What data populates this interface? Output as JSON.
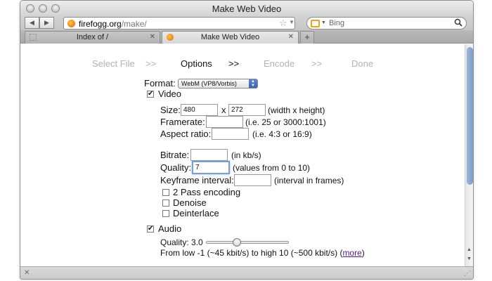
{
  "window": {
    "title": "Make Web Video"
  },
  "navbar": {
    "back_icon": "back-arrow-icon",
    "forward_icon": "forward-arrow-icon",
    "url_host": "firefogg.org",
    "url_path": "/make/",
    "search_engine": "Bing",
    "search_placeholder": "Bing"
  },
  "tabs": [
    {
      "label": "Index of /",
      "active": false
    },
    {
      "label": "Make Web Video",
      "active": true
    }
  ],
  "steps": {
    "select_file": "Select File",
    "sep1": ">>",
    "options": "Options",
    "sep2": ">>",
    "encode": "Encode",
    "sep3": ">>",
    "done": "Done",
    "current": "Options"
  },
  "form": {
    "format_label": "Format:",
    "format_value": "WebM (VP8/Vorbis)",
    "video_label": "Video",
    "video_checked": true,
    "size_label": "Size:",
    "width_value": "480",
    "size_x": "x",
    "height_value": "272",
    "size_note": "(width x height)",
    "framerate_label": "Framerate:",
    "framerate_value": "",
    "framerate_note": "(i.e. 25 or 3000:1001)",
    "aspect_label": "Aspect ratio:",
    "aspect_value": "",
    "aspect_note": "(i.e. 4:3 or 16:9)",
    "bitrate_label": "Bitrate:",
    "bitrate_value": "",
    "bitrate_note": "(in kb/s)",
    "quality_label": "Quality:",
    "quality_value": "7",
    "quality_note": "(values from 0 to 10)",
    "keyframe_label": "Keyframe interval:",
    "keyframe_value": "",
    "keyframe_note": "(interval in frames)",
    "twopass_label": "2 Pass encoding",
    "twopass_checked": false,
    "denoise_label": "Denoise",
    "denoise_checked": false,
    "deinterlace_label": "Deinterlace",
    "deinterlace_checked": false,
    "audio_label": "Audio",
    "audio_checked": true,
    "audio_quality_label": "Quality: 3.0",
    "audio_quality_fraction": 0.36,
    "audio_range_text": "From low -1 (~45 kbit/s) to high 10 (~500 kbit/s) (",
    "more_link": "more",
    "audio_range_close": ")"
  },
  "colors": {
    "inactive_step": "#b2b2b2",
    "link": "#551a8b",
    "focus_ring": "#7a9fd1"
  }
}
